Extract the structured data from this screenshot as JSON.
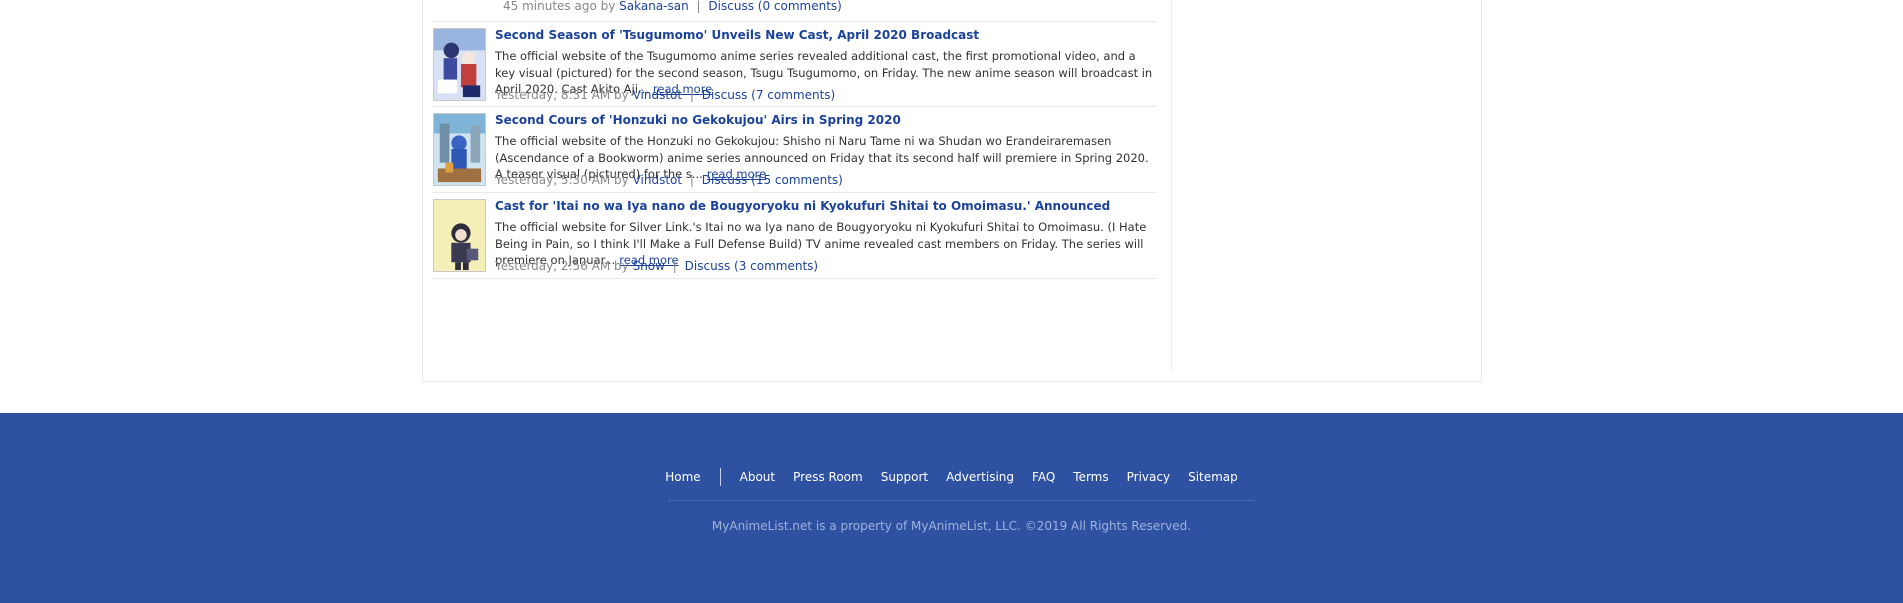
{
  "top_meta": {
    "time_by": "45 minutes ago by",
    "author": "Sakana-san",
    "discuss": "Discuss (0 comments)"
  },
  "news": [
    {
      "title": "Second Season of 'Tsugumomo' Unveils New Cast, April 2020 Broadcast",
      "text": "The official website of the Tsugumomo anime series revealed additional cast, the first promotional video, and a key visual (pictured) for the second season, Tsugu Tsugumomo, on Friday. The new anime season will broadcast in April 2020. Cast Akito Aji...",
      "read_more": "read more",
      "time_by": "Yesterday, 8:31 AM by",
      "author": "Vindstot",
      "discuss": "Discuss (7 comments)"
    },
    {
      "title": "Second Cours of 'Honzuki no Gekokujou' Airs in Spring 2020",
      "text": "The official website of the Honzuki no Gekokujou: Shisho ni Naru Tame ni wa Shudan wo Erandeiraremasen (Ascendance of a Bookworm) anime series announced on Friday that its second half will premiere in Spring 2020. A teaser visual (pictured) for the s...",
      "read_more": "read more",
      "time_by": "Yesterday, 5:30 AM by",
      "author": "Vindstot",
      "discuss": "Discuss (15 comments)"
    },
    {
      "title": "Cast for 'Itai no wa Iya nano de Bougyoryoku ni Kyokufuri Shitai to Omoimasu.' Announced",
      "text": "The official website for Silver Link.'s Itai no wa Iya nano de Bougyoryoku ni Kyokufuri Shitai to Omoimasu. (I Hate Being in Pain, so I think I'll Make a Full Defense Build) TV anime revealed cast members on Friday. The series will premiere on Januar...",
      "read_more": "read more",
      "time_by": "Yesterday, 2:56 AM by",
      "author": "Snow",
      "discuss": "Discuss (3 comments)"
    }
  ],
  "footer": {
    "links": [
      "Home",
      "About",
      "Press Room",
      "Support",
      "Advertising",
      "FAQ",
      "Terms",
      "Privacy",
      "Sitemap"
    ],
    "copyright": "MyAnimeList.net is a property of MyAnimeList, LLC. ©2019 All Rights Reserved."
  },
  "colors": {
    "link": "#1c439b",
    "footer_bg": "#2e51a2",
    "meta_text": "#888888"
  }
}
